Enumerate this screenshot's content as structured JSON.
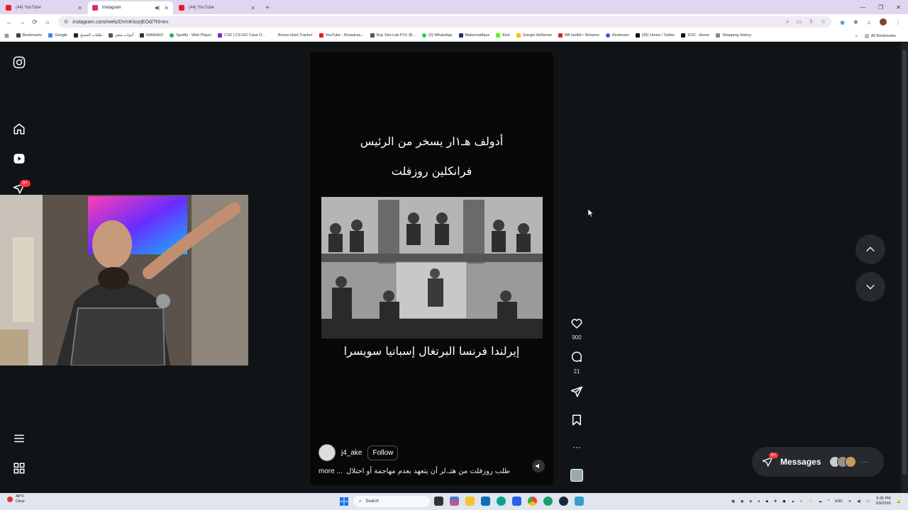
{
  "tabs": [
    {
      "title": "(44) YouTube",
      "active": false,
      "color": "#e02020"
    },
    {
      "title": "Instagram",
      "active": true,
      "color": "#d62976"
    },
    {
      "title": "(44) YouTube",
      "active": false,
      "color": "#e02020"
    }
  ],
  "url": "instagram.com/reels/DVmKkozjEOd/?hl=en",
  "bookmarks": [
    {
      "label": "Bookmarks",
      "color": "#444"
    },
    {
      "label": "Google",
      "color": "#4285f4"
    },
    {
      "label": "طلبات المسح",
      "color": "#222"
    },
    {
      "label": "أدوات متجر",
      "color": "#555"
    },
    {
      "label": "MAHHKO",
      "color": "#333"
    },
    {
      "label": "Spotify - Web Player",
      "color": "#1db954"
    },
    {
      "label": "CS2 | CS:GO Case O...",
      "color": "#7b2ccf"
    },
    {
      "label": "Bonus Hunt Tracker",
      "color": "#ffffff"
    },
    {
      "label": "YouTube - Broadcas...",
      "color": "#e02020"
    },
    {
      "label": "Buy Sim-Lab P1X (B...",
      "color": "#555"
    },
    {
      "label": "(2) WhatsApp",
      "color": "#25d366"
    },
    {
      "label": "Makersrafique",
      "color": "#223366"
    },
    {
      "label": "Kick",
      "color": "#53fc18"
    },
    {
      "label": "Google AdSense",
      "color": "#fbbc05"
    },
    {
      "label": "BB toolkit • Streams",
      "color": "#c4302b"
    },
    {
      "label": "Restream",
      "color": "#3a5bd9"
    },
    {
      "label": "(36) Home / Twitter",
      "color": "#111"
    },
    {
      "label": "ICIO - Home",
      "color": "#111"
    },
    {
      "label": "Shopping history",
      "color": "#888"
    }
  ],
  "all_bookmarks": "All Bookmarks",
  "sidebar": {
    "notification_count": "9+"
  },
  "reel": {
    "caption_line1": "أدولف هـ١ار يسخر من الرئيس",
    "caption_line2": "فرانكلين  روزفلت",
    "countries": "إيرلندا فرنسا البرتغال إسبانيا  سويسرا",
    "username": "j4_ake",
    "follow_label": "Follow",
    "description": "طلب روزفلت من هتـ.لر أن يتعهد بعدم مهاجمة أو احتلال",
    "more_label": "more ..."
  },
  "actions": {
    "likes": "900",
    "comments": "21"
  },
  "messages": {
    "label": "Messages",
    "notification_count": "9+"
  },
  "taskbar": {
    "weather_temp": "48°F",
    "weather_cond": "Clear",
    "search_placeholder": "Search",
    "lang": "ENG",
    "time": "9:35 PM",
    "date": "3/9/2026"
  }
}
